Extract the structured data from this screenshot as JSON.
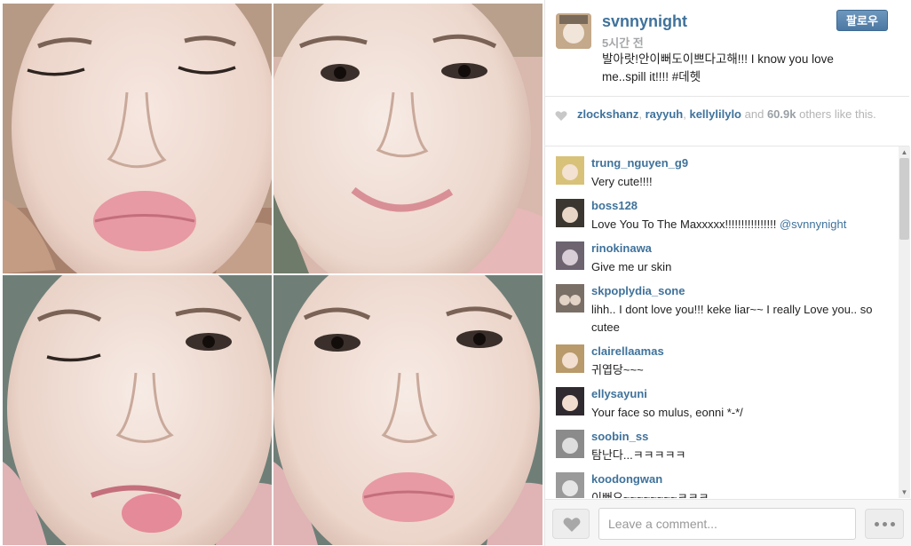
{
  "photos": [
    {
      "expression": "eyes closed, pouting lips"
    },
    {
      "expression": "squinting smile"
    },
    {
      "expression": "winking, tongue out"
    },
    {
      "expression": "pouting, looking at camera"
    }
  ],
  "post": {
    "username": "svnnynight",
    "time": "5시간 전",
    "caption": "발아랏!안이뻐도이쁘다고해!!! I know you love me..spill it!!!! #데헷",
    "follow_label": "팔로우"
  },
  "likes": {
    "users": [
      "zlockshanz",
      "rayyuh",
      "kellylilylo"
    ],
    "sep1": ", ",
    "sep2": ", ",
    "and_text": " and ",
    "count": "60.9k",
    "others_text": " others like this."
  },
  "comments": [
    {
      "user": "trung_nguyen_g9",
      "text": "Very cute!!!!",
      "avatar_color": "#d8c27a"
    },
    {
      "user": "boss128",
      "text": "Love You To The Maxxxxx!!!!!!!!!!!!!!!! ",
      "mention": "@svnnynight",
      "avatar_color": "#3b3630"
    },
    {
      "user": "rinokinawa",
      "text": "Give me ur skin",
      "avatar_color": "#6d6470"
    },
    {
      "user": "skpoplydia_sone",
      "text": "lihh.. I dont love you!!! keke liar~~ I really Love you.. so cutee",
      "avatar_color": "#7a6f66"
    },
    {
      "user": "clairellaamas",
      "text": "귀엽당~~~",
      "avatar_color": "#b89a6b"
    },
    {
      "user": "ellysayuni",
      "text": "Your face so mulus, eonni *-*/",
      "avatar_color": "#2f2a30"
    },
    {
      "user": "soobin_ss",
      "text": "탐난다...ㅋㅋㅋㅋㅋ",
      "avatar_color": "#8b8b8b"
    },
    {
      "user": "koodongwan",
      "text": "이뻐요~~~~~~~~ㅋㅋㅋ",
      "avatar_color": "#9a9a9a"
    }
  ],
  "footer": {
    "comment_placeholder": "Leave a comment..."
  },
  "colors": {
    "link": "#3f729b",
    "follow_button": "#517fa4",
    "likes_gray": "#b4b4b4"
  },
  "icons": {
    "like_small": "heart-icon",
    "like_button": "heart-icon",
    "more_button": "ellipsis-icon"
  }
}
